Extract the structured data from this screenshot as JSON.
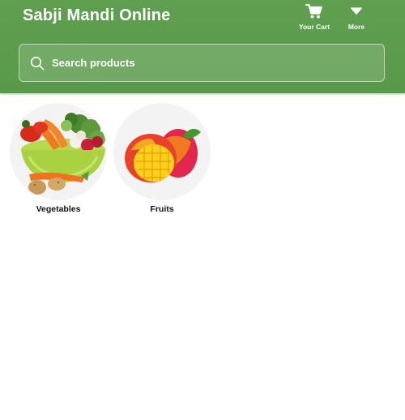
{
  "header": {
    "title": "Sabji Mandi Online",
    "background": "#5b9c4c",
    "actions": [
      {
        "label": "Your Cart",
        "icon": "cart-icon"
      },
      {
        "label": "More",
        "icon": "caret-down-icon"
      }
    ]
  },
  "search": {
    "placeholder": "Search products",
    "value": "",
    "icon": "search-icon"
  },
  "categories": [
    {
      "name": "Vegetables",
      "image": "vegetable-basket-image"
    },
    {
      "name": "Fruits",
      "image": "mango-image"
    }
  ]
}
